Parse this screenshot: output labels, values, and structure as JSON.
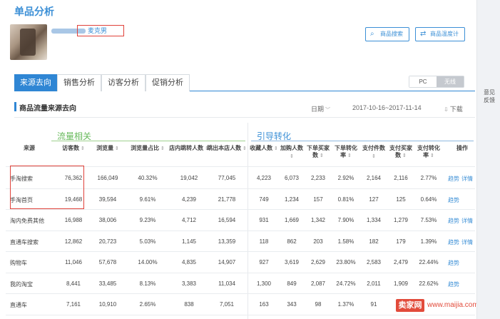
{
  "page": {
    "title": "单品分析"
  },
  "product": {
    "shop_name": "麦克男"
  },
  "actions": {
    "search_label": "商品搜索",
    "benchmark_label": "商品温度计"
  },
  "tabs": [
    {
      "label": "来源去向",
      "active": true
    },
    {
      "label": "销售分析",
      "active": false
    },
    {
      "label": "访客分析",
      "active": false
    },
    {
      "label": "促销分析",
      "active": false
    }
  ],
  "device": {
    "pc": "PC",
    "wireless": "无线",
    "selected": "无线"
  },
  "section": {
    "title": "商品流量来源去向",
    "period_label": "日期",
    "date_range": "2017-10-16~2017-11-14",
    "download_label": "下载"
  },
  "groups": {
    "traffic": "流量相关",
    "conversion": "引导转化"
  },
  "sidebar": {
    "feedback_line1": "意见",
    "feedback_line2": "反馈"
  },
  "table": {
    "headers": {
      "source": "来源",
      "visitors": "访客数",
      "pageviews": "浏览量",
      "pv_share": "浏览量占比",
      "in_store_jump": "店内跳转人数",
      "exit": "跳出本店人数",
      "favorites": "收藏人数",
      "cart": "加购人数",
      "order_buyers": "下单买家数",
      "order_conv": "下单转化率",
      "paid_items": "支付件数",
      "paid_buyers": "支付买家数",
      "paid_conv": "支付转化率",
      "ops": "操作"
    },
    "rows": [
      {
        "source": "手淘搜索",
        "visitors": "76,362",
        "pageviews": "166,049",
        "pv_share": "40.32%",
        "in_store_jump": "19,042",
        "exit": "77,045",
        "favorites": "4,223",
        "cart": "6,073",
        "order_buyers": "2,233",
        "order_conv": "2.92%",
        "paid_items": "2,164",
        "paid_buyers": "2,116",
        "paid_conv": "2.77%",
        "action1": "趋势",
        "action2": "详情"
      },
      {
        "source": "手淘首页",
        "visitors": "19,468",
        "pageviews": "39,594",
        "pv_share": "9.61%",
        "in_store_jump": "4,239",
        "exit": "21,778",
        "favorites": "749",
        "cart": "1,234",
        "order_buyers": "157",
        "order_conv": "0.81%",
        "paid_items": "127",
        "paid_buyers": "125",
        "paid_conv": "0.64%",
        "action1": "趋势",
        "action2": ""
      },
      {
        "source": "淘内免费其他",
        "visitors": "16,988",
        "pageviews": "38,006",
        "pv_share": "9.23%",
        "in_store_jump": "4,712",
        "exit": "16,594",
        "favorites": "931",
        "cart": "1,669",
        "order_buyers": "1,342",
        "order_conv": "7.90%",
        "paid_items": "1,334",
        "paid_buyers": "1,279",
        "paid_conv": "7.53%",
        "action1": "趋势",
        "action2": "详情"
      },
      {
        "source": "直通车搜索",
        "visitors": "12,862",
        "pageviews": "20,723",
        "pv_share": "5.03%",
        "in_store_jump": "1,145",
        "exit": "13,359",
        "favorites": "118",
        "cart": "862",
        "order_buyers": "203",
        "order_conv": "1.58%",
        "paid_items": "182",
        "paid_buyers": "179",
        "paid_conv": "1.39%",
        "action1": "趋势",
        "action2": "详情"
      },
      {
        "source": "购物车",
        "visitors": "11,046",
        "pageviews": "57,678",
        "pv_share": "14.00%",
        "in_store_jump": "4,835",
        "exit": "14,907",
        "favorites": "927",
        "cart": "3,619",
        "order_buyers": "2,629",
        "order_conv": "23.80%",
        "paid_items": "2,583",
        "paid_buyers": "2,479",
        "paid_conv": "22.44%",
        "action1": "趋势",
        "action2": ""
      },
      {
        "source": "我的淘宝",
        "visitors": "8,441",
        "pageviews": "33,485",
        "pv_share": "8.13%",
        "in_store_jump": "3,383",
        "exit": "11,034",
        "favorites": "1,300",
        "cart": "849",
        "order_buyers": "2,087",
        "order_conv": "24.72%",
        "paid_items": "2,011",
        "paid_buyers": "1,909",
        "paid_conv": "22.62%",
        "action1": "趋势",
        "action2": ""
      },
      {
        "source": "直通车",
        "visitors": "7,161",
        "pageviews": "10,910",
        "pv_share": "2.65%",
        "in_store_jump": "838",
        "exit": "7,051",
        "favorites": "163",
        "cart": "343",
        "order_buyers": "98",
        "order_conv": "1.37%",
        "paid_items": "91",
        "paid_buyers": "",
        "paid_conv": "",
        "action1": "",
        "action2": ""
      }
    ]
  },
  "watermark": {
    "brand": "卖家网",
    "url": "www.maijia.com"
  }
}
